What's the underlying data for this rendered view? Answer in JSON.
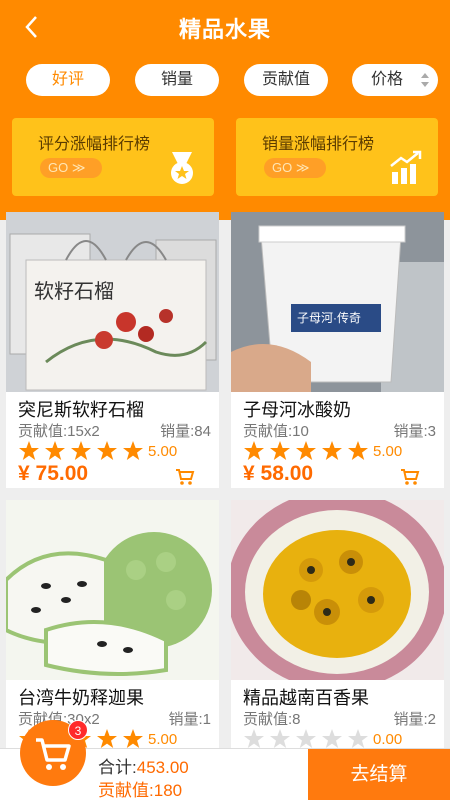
{
  "header": {
    "title": "精品水果"
  },
  "sort_tabs": [
    {
      "label": "好评",
      "active": true
    },
    {
      "label": "销量",
      "active": false
    },
    {
      "label": "贡献值",
      "active": false
    },
    {
      "label": "价格",
      "active": false
    }
  ],
  "rank_banners": [
    {
      "title": "评分涨幅排行榜",
      "go": "GO ≫",
      "icon": "medal-star-icon"
    },
    {
      "title": "销量涨幅排行榜",
      "go": "GO ≫",
      "icon": "bar-chart-up-icon"
    }
  ],
  "products": [
    {
      "name": "突尼斯软籽石榴",
      "contribution": "贡献值:15x2",
      "sales": "销量:84",
      "rating": "5.00",
      "stars": 5,
      "price": "¥ 75.00",
      "image": "pomegranate-gift-box",
      "image_text": "软籽石榴"
    },
    {
      "name": "子母河冰酸奶",
      "contribution": "贡献值:10",
      "sales": "销量:3",
      "rating": "5.00",
      "stars": 5,
      "price": "¥ 58.00",
      "image": "yogurt-cup",
      "image_text": "子母河·传奇"
    },
    {
      "name": "台湾牛奶释迦果",
      "contribution": "贡献值:30x2",
      "sales": "销量:1",
      "rating": "5.00",
      "stars": 5,
      "price": "",
      "image": "sugar-apple"
    },
    {
      "name": "精品越南百香果",
      "contribution": "贡献值:8",
      "sales": "销量:2",
      "rating": "0.00",
      "stars": 0,
      "price": "",
      "image": "passion-fruit"
    }
  ],
  "footer": {
    "cart_count": "3",
    "total_label": "合计:",
    "total_value": "453.00",
    "contrib_label": "贡献值:",
    "contrib_value": "180",
    "checkout_label": "去结算"
  },
  "colors": {
    "primary": "#ff8a00",
    "banner": "#ffc21a",
    "price": "#ff6a00",
    "checkout": "#ff7a0e",
    "badge": "#ff2a2a"
  }
}
